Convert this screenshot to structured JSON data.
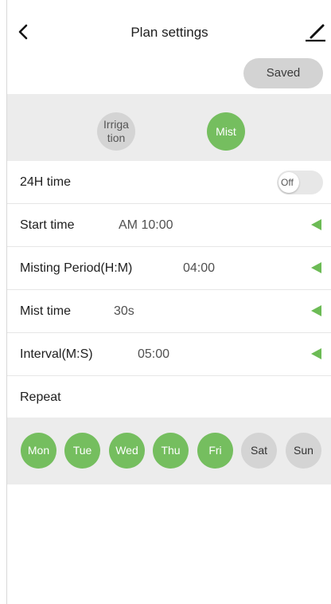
{
  "header": {
    "title": "Plan settings",
    "saved_label": "Saved"
  },
  "modes": {
    "irrigation_label": "Irriga\ntion",
    "mist_label": "Mist",
    "selected": "Mist"
  },
  "settings": {
    "h24": {
      "label": "24H time",
      "toggle": "Off"
    },
    "start_time": {
      "label": "Start time",
      "value": "AM 10:00"
    },
    "misting_period": {
      "label": "Misting Period(H:M)",
      "value": "04:00"
    },
    "mist_time": {
      "label": "Mist time",
      "value": "30s"
    },
    "interval": {
      "label": "Interval(M:S)",
      "value": "05:00"
    },
    "repeat": {
      "label": "Repeat"
    }
  },
  "days": [
    {
      "label": "Mon",
      "active": true
    },
    {
      "label": "Tue",
      "active": true
    },
    {
      "label": "Wed",
      "active": true
    },
    {
      "label": "Thu",
      "active": true
    },
    {
      "label": "Fri",
      "active": true
    },
    {
      "label": "Sat",
      "active": false
    },
    {
      "label": "Sun",
      "active": false
    }
  ],
  "colors": {
    "accent_green": "#75be5f",
    "inactive_gray": "#d4d4d4",
    "panel_gray": "#ececec"
  },
  "icons": {
    "back": "chevron-left-icon",
    "edit": "edit-pen-icon",
    "expand": "triangle-left-icon"
  }
}
